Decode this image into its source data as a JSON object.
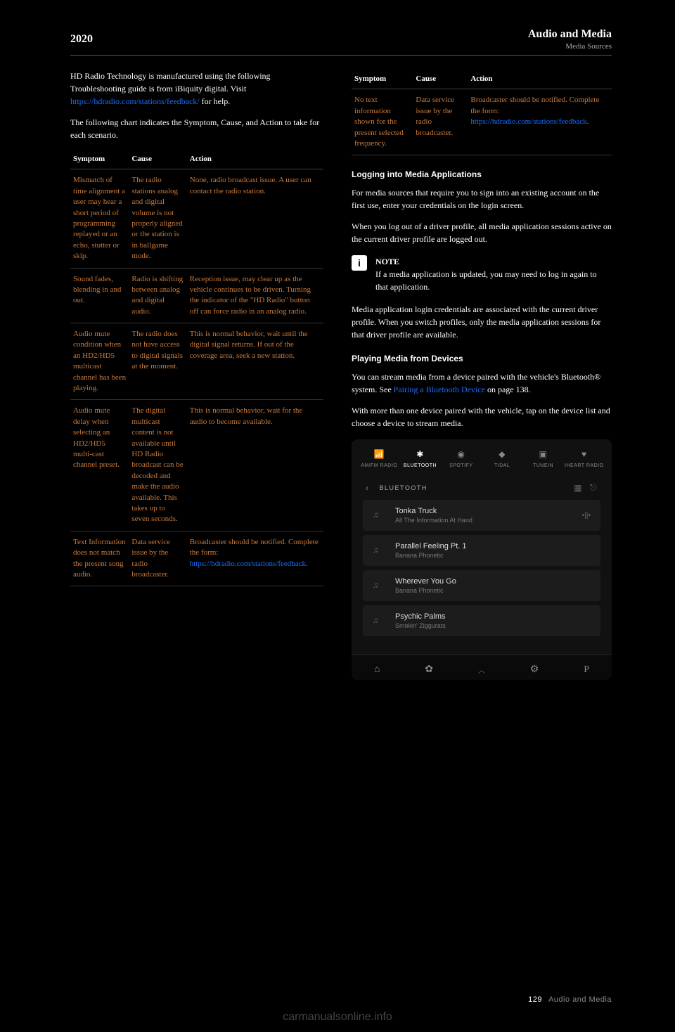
{
  "header": {
    "left": "2020",
    "title": "Audio and Media",
    "subtitle": "Media Sources"
  },
  "intro": {
    "pre": "HD Radio Technology is manufactured using the following Troubleshooting guide is from iBiquity digital. Visit ",
    "link1_text": "https://hdradio.com/stations/feedback/",
    "post1": " for help."
  },
  "table_intro": "The following chart indicates the Symptom, Cause, and Action to take for each scenario.",
  "table_headers": {
    "c1": "Symptom",
    "c2": "Cause",
    "c3": "Action"
  },
  "rows": [
    {
      "s": "Mismatch of time alignment a user may hear a short period of programming replayed or an echo, stutter or skip.",
      "c": "The radio stations analog and digital volume is not properly aligned or the station is in ballgame mode.",
      "a": "None, radio broadcast issue. A user can contact the radio station."
    },
    {
      "s": "Sound fades, blending in and out.",
      "c": "Radio is shifting between analog and digital audio.",
      "a": "Reception issue, may clear up as the vehicle continues to be driven. Turning the indicator of the \"HD Radio\" button off can force radio in an analog radio."
    },
    {
      "s": "Audio mute condition when an HD2/HD5 multicast channel has been playing.",
      "c": "The radio does not have access to digital signals at the moment.",
      "a": "This is normal behavior, wait until the digital signal returns. If out of the coverage area, seek a new station."
    },
    {
      "s": "Audio mute delay when selecting an HD2/HD5 multi-cast channel preset.",
      "c": "The digital multicast content is not available until HD Radio broadcast can be decoded and make the audio available. This takes up to seven seconds.",
      "a": "This is normal behavior, wait for the audio to become available."
    },
    {
      "s": "Text Information does not match the present song audio.",
      "c": "Data service issue by the radio broadcaster.",
      "a_pre": "Broadcaster should be notified. Complete the form: ",
      "a_link": "https://hdradio.com/stations/feedback",
      "a_post": "."
    }
  ],
  "right_row": {
    "s": "No text information shown for the present selected frequency.",
    "c": "Data service issue by the radio broadcaster.",
    "a_pre": "Broadcaster should be notified. Complete the form: ",
    "a_link": "https://hdradio.com/stations/feedback",
    "a_post": "."
  },
  "sec1_h": "Logging into Media Applications",
  "sec1_p1": "For media sources that require you to sign into an existing account on the first use, enter your credentials on the login screen.",
  "sec1_p2": "When you log out of a driver profile, all media application sessions active on the current driver profile are logged out.",
  "note_label": "NOTE",
  "note_text": "If a media application is updated, you may need to log in again to that application.",
  "sec1_p3": "Media application login credentials are associated with the current driver profile. When you switch profiles, only the media application sessions for that driver profile are available.",
  "sec2_h": "Playing Media from Devices",
  "sec2_p1_pre": "You can stream media from a device paired with the vehicle's Bluetooth® system. See ",
  "sec2_link": "Pairing a Bluetooth Device",
  "sec2_p1_post": " on page 138.",
  "sec2_p2": "With more than one device paired with the vehicle, tap on the device list and choose a device to stream media.",
  "screenshot": {
    "sources": [
      {
        "label": "AM/FM RADIO",
        "active": false
      },
      {
        "label": "BLUETOOTH",
        "active": true
      },
      {
        "label": "SPOTIFY",
        "active": false
      },
      {
        "label": "TIDAL",
        "active": false
      },
      {
        "label": "TUNEIN",
        "active": false
      },
      {
        "label": "IHEART RADIO",
        "active": false
      }
    ],
    "bt_label": "BLUETOOTH",
    "tracks": [
      {
        "title": "Tonka Truck",
        "artist": "All The Information At Hand",
        "now": true
      },
      {
        "title": "Parallel Feeling Pt. 1",
        "artist": "Banana Phonetic",
        "now": false
      },
      {
        "title": "Wherever You Go",
        "artist": "Banana Phonetic",
        "now": false
      },
      {
        "title": "Psychic Palms",
        "artist": "Smokin' Ziggurats",
        "now": false
      }
    ]
  },
  "footer": {
    "page": "129",
    "text": "Audio and Media"
  },
  "watermark": "carmanualsonline.info"
}
